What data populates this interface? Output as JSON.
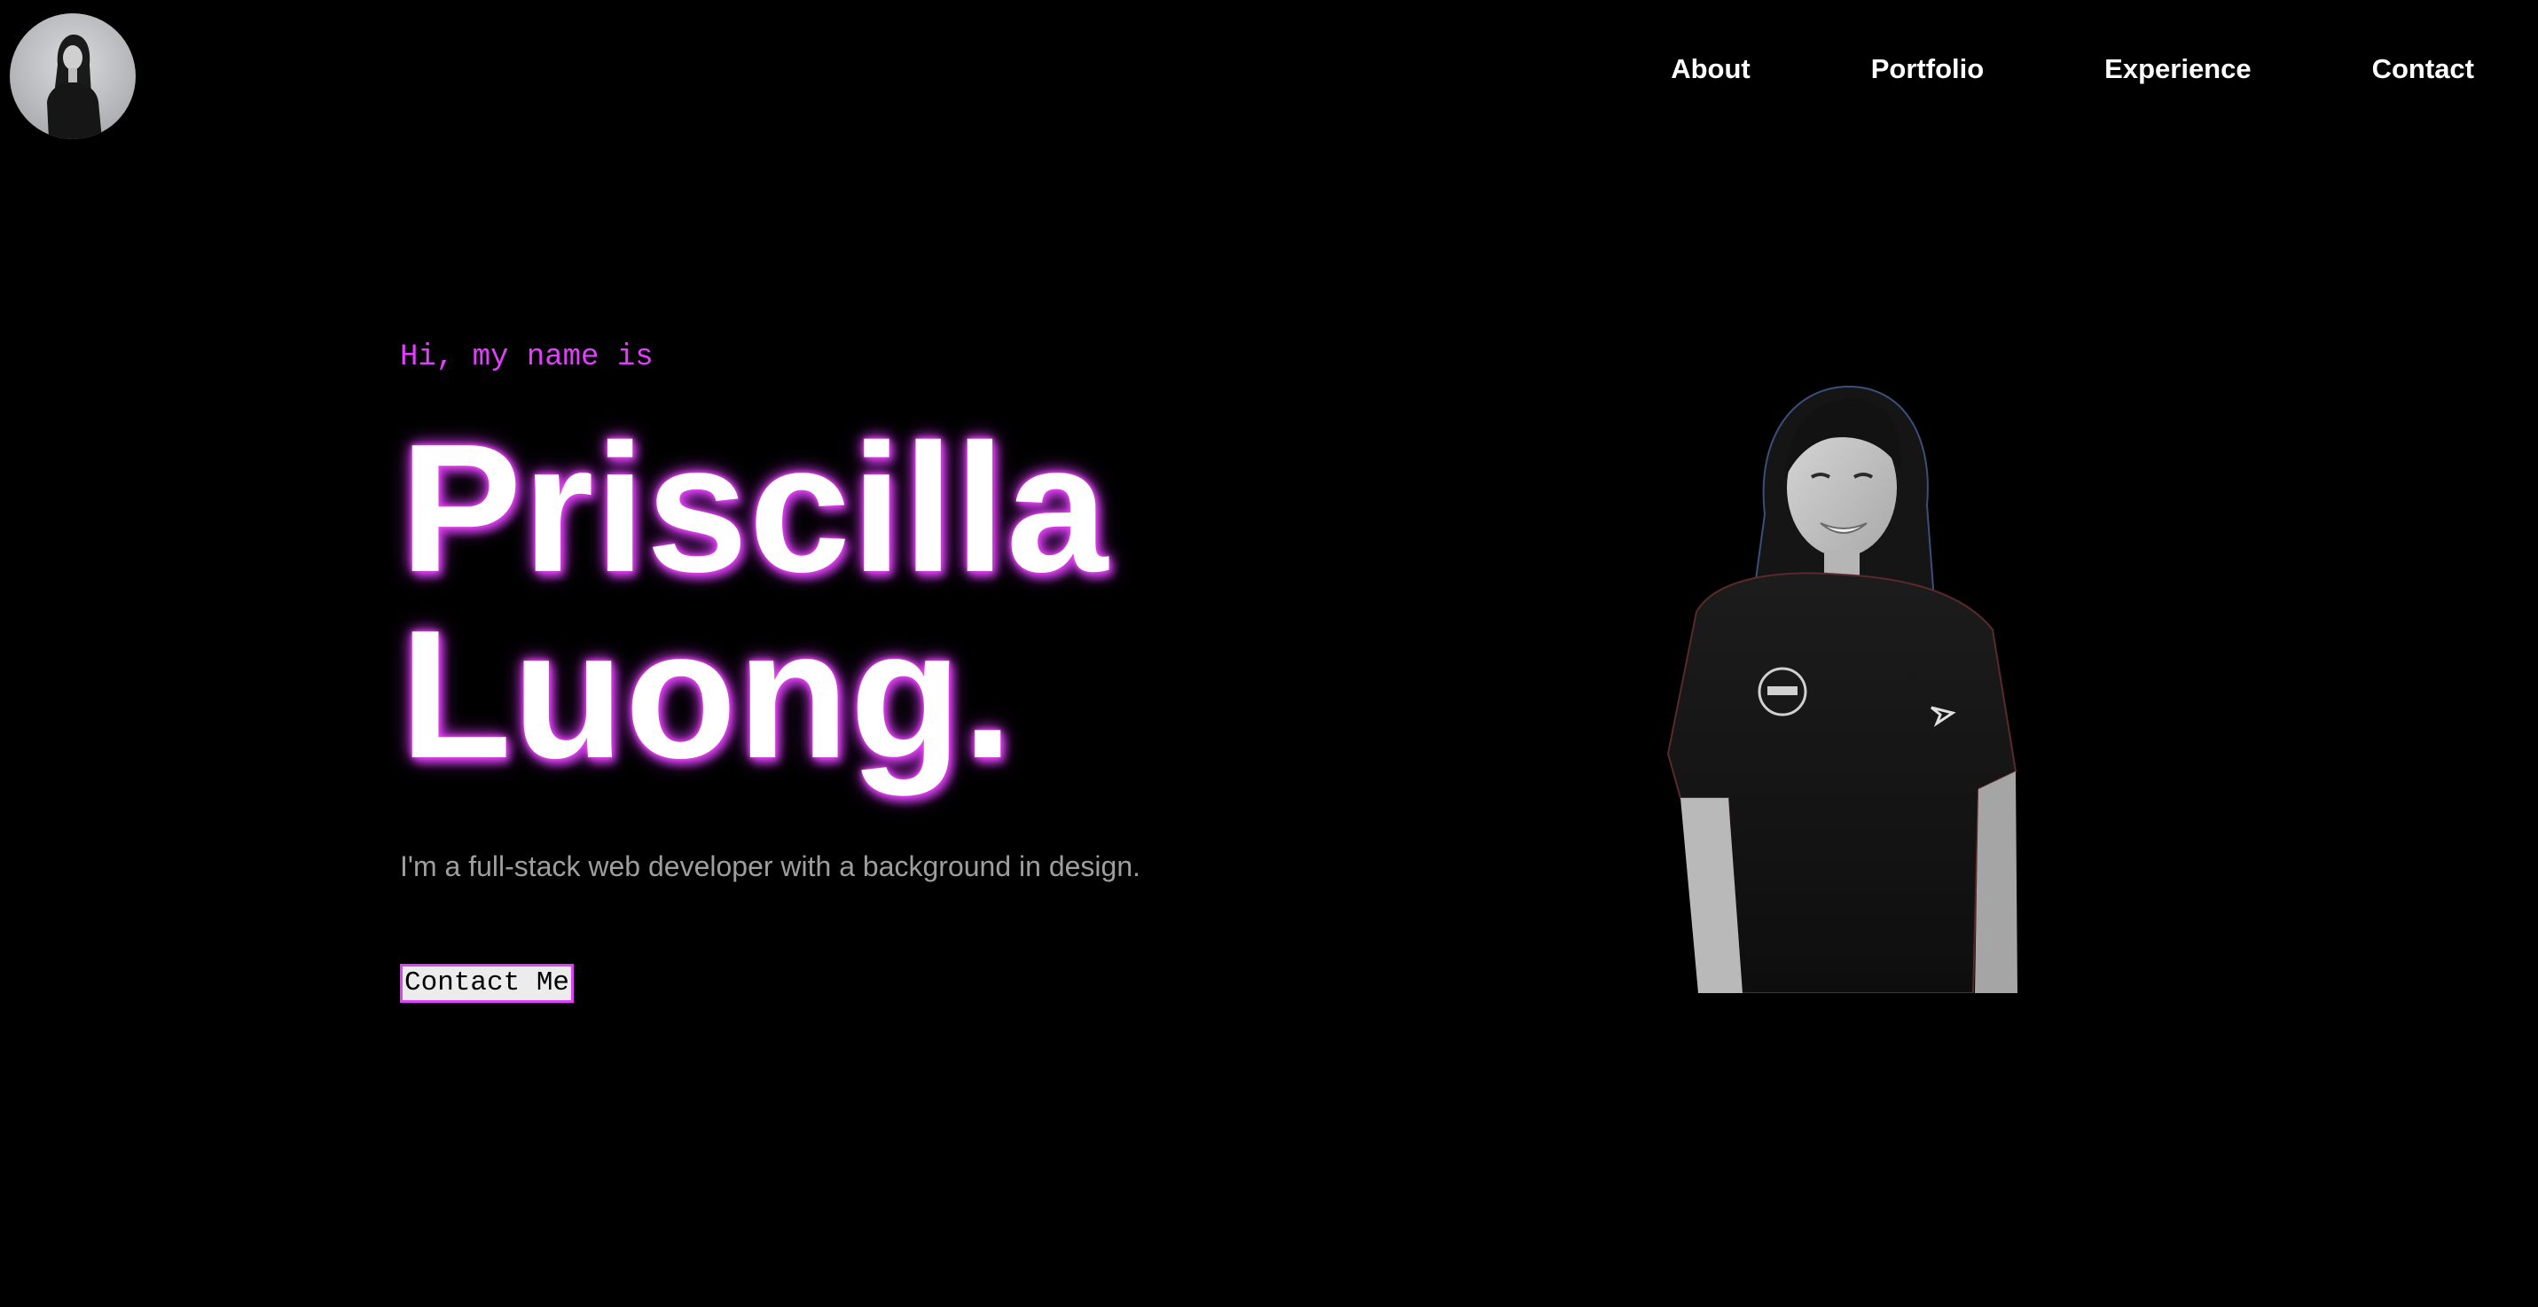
{
  "header": {
    "avatar_icon": "profile-photo-avatar",
    "nav": [
      {
        "label": "About"
      },
      {
        "label": "Portfolio"
      },
      {
        "label": "Experience"
      },
      {
        "label": "Contact"
      }
    ]
  },
  "hero": {
    "greeting": "Hi, my name is",
    "name_line1": "Priscilla",
    "name_line2": "Luong.",
    "tagline": "I'm a full-stack web developer with a background in design.",
    "cta_label": "Contact Me",
    "portrait_icon": "portrait-photo"
  },
  "colors": {
    "background": "#000000",
    "accent": "#e040fb",
    "text": "#ffffff",
    "muted": "#9e9e9e"
  }
}
